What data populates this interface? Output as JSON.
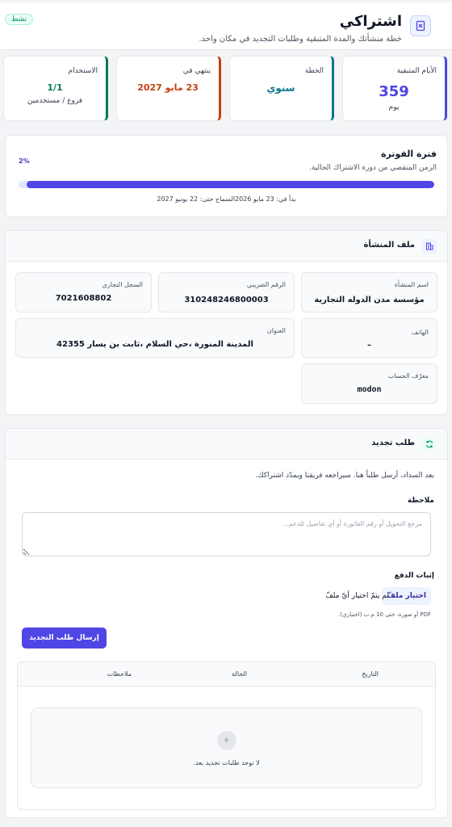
{
  "header": {
    "title": "اشتراكي",
    "subtitle": "خطة منشأتك والمدة المتبقية وطلبات التجديد في مكان واحد.",
    "status_badge": "نشط",
    "icon": "receipt-icon"
  },
  "stats": {
    "remaining": {
      "label": "الأيام المتبقية",
      "value": "359",
      "note": "يوم",
      "color": "#4f46e5"
    },
    "plan": {
      "label": "الخطة",
      "value": "سنوي",
      "color": "#0e7490"
    },
    "ends": {
      "label": "ينتهي في",
      "value": "23 مايو 2027",
      "color": "#c2410c"
    },
    "usage": {
      "label": "الاستخدام",
      "value": "1/1",
      "note": "فروع / مستخدمين",
      "color": "#047857"
    }
  },
  "billing": {
    "title": "فترة الفوترة",
    "description": "الزمن المنقضي من دورة الاشتراك الحالية.",
    "percent_label": "2%",
    "progress": 0.98,
    "dates": "بدأ في: 23 مايو 2026السماح حتى: 22 يونيو 2027"
  },
  "organization": {
    "title": "ملف المنشأة",
    "icon": "building-icon",
    "fields": {
      "name": {
        "label": "اسم المنشأة",
        "value": "مؤسسة مدن الدوله التجارية"
      },
      "tax": {
        "label": "الرقم الضريبي",
        "value": "310248246800003"
      },
      "cr": {
        "label": "السجل التجاري",
        "value": "7021608802"
      },
      "phone": {
        "label": "الهاتف",
        "value": "–"
      },
      "address": {
        "label": "العنوان",
        "value": "المدينة المنورة ،حي السلام ،ثابت بن يسار 42355"
      },
      "account_id": {
        "label": "معرّف الحساب",
        "value": "modon"
      }
    }
  },
  "renewal": {
    "title": "طلب تجديد",
    "icon": "refresh-icon",
    "description": "بعد السداد، أرسل طلباً هنا. سيراجعه فريقنا ويمدّد اشتراكك.",
    "note_label": "ملاحظة",
    "note_placeholder": "مرجع التحويل أو رقم الفاتورة أو أي تفاصيل للدعم...",
    "proof_label": "إثبات الدفع",
    "file_button": "اختيار ملفّ",
    "file_status": "لم يتمّ اختيار أيّ ملفّ",
    "file_hint": "PDF أو صورة، حتى 10 م.ب (اختياري).",
    "submit": "إرسال طلب التجديد",
    "table": {
      "columns": [
        "التاريخ",
        "الحالة",
        "ملاحظات"
      ],
      "empty_text": "لا توجد طلبات تجديد بعد."
    }
  }
}
